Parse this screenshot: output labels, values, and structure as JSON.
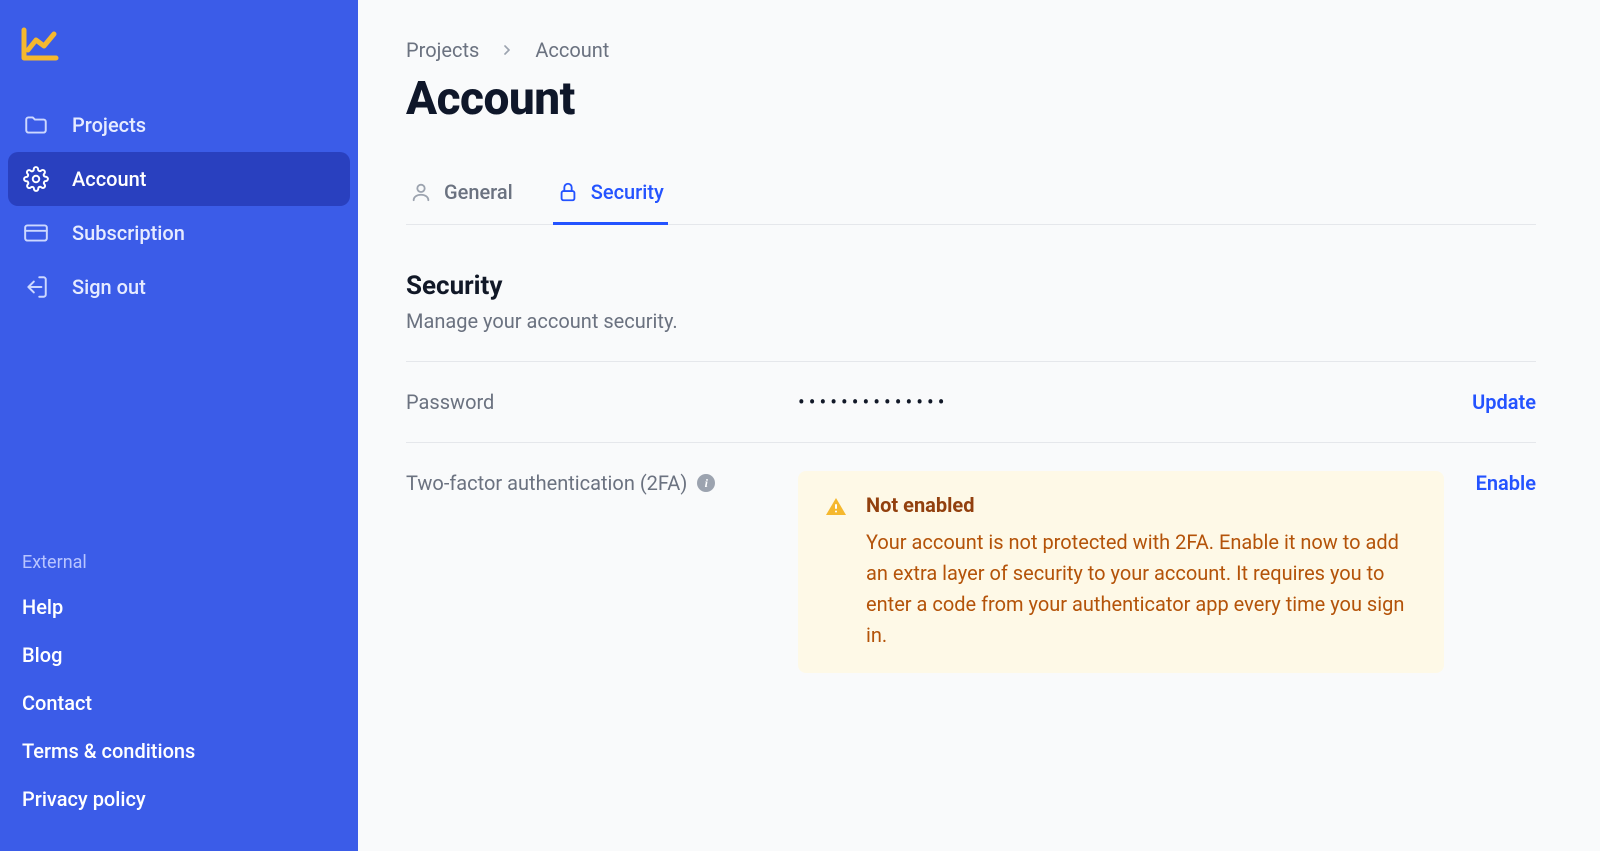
{
  "sidebar": {
    "nav": [
      {
        "id": "projects",
        "label": "Projects",
        "icon": "folder-icon",
        "active": false
      },
      {
        "id": "account",
        "label": "Account",
        "icon": "gear-icon",
        "active": true
      },
      {
        "id": "subscription",
        "label": "Subscription",
        "icon": "credit-card-icon",
        "active": false
      },
      {
        "id": "signout",
        "label": "Sign out",
        "icon": "signout-icon",
        "active": false
      }
    ],
    "external_heading": "External",
    "external": [
      {
        "label": "Help"
      },
      {
        "label": "Blog"
      },
      {
        "label": "Contact"
      },
      {
        "label": "Terms & conditions"
      },
      {
        "label": "Privacy policy"
      }
    ]
  },
  "breadcrumb": {
    "items": [
      "Projects",
      "Account"
    ]
  },
  "page": {
    "title": "Account"
  },
  "tabs": [
    {
      "id": "general",
      "label": "General",
      "icon": "user-icon",
      "active": false
    },
    {
      "id": "security",
      "label": "Security",
      "icon": "lock-icon",
      "active": true
    }
  ],
  "section": {
    "title": "Security",
    "subtitle": "Manage your account security."
  },
  "settings": {
    "password": {
      "label": "Password",
      "masked_value": "••••••••••••••",
      "action": "Update"
    },
    "twofa": {
      "label": "Two-factor authentication (2FA)",
      "action": "Enable",
      "alert_title": "Not enabled",
      "alert_text": "Your account is not protected with 2FA. Enable it now to add an extra layer of security to your account. It requires you to enter a code from your authenticator app every time you sign in."
    }
  },
  "colors": {
    "sidebar_bg": "#3b5ce8",
    "sidebar_active_bg": "#2940bf",
    "accent": "#2453ff",
    "logo": "#f5b82e",
    "alert_bg": "#fef9e7",
    "alert_title": "#92400e",
    "alert_text": "#b45309"
  }
}
